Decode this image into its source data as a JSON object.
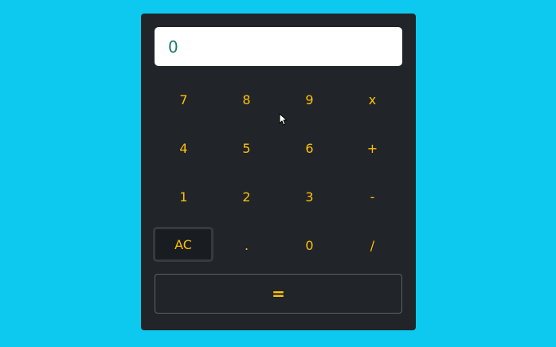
{
  "colors": {
    "page_background": "#0ec9ef",
    "panel_background": "#212529",
    "key_text": "#ffc107",
    "display_text": "#1b7a67"
  },
  "display": {
    "value": "0"
  },
  "keys": {
    "row1": [
      "7",
      "8",
      "9",
      "x"
    ],
    "row2": [
      "4",
      "5",
      "6",
      "+"
    ],
    "row3": [
      "1",
      "2",
      "3",
      "-"
    ],
    "row4": [
      "AC",
      ".",
      "0",
      "/"
    ]
  },
  "equals_label": "=",
  "cursor_icon": "mouse-pointer-icon"
}
